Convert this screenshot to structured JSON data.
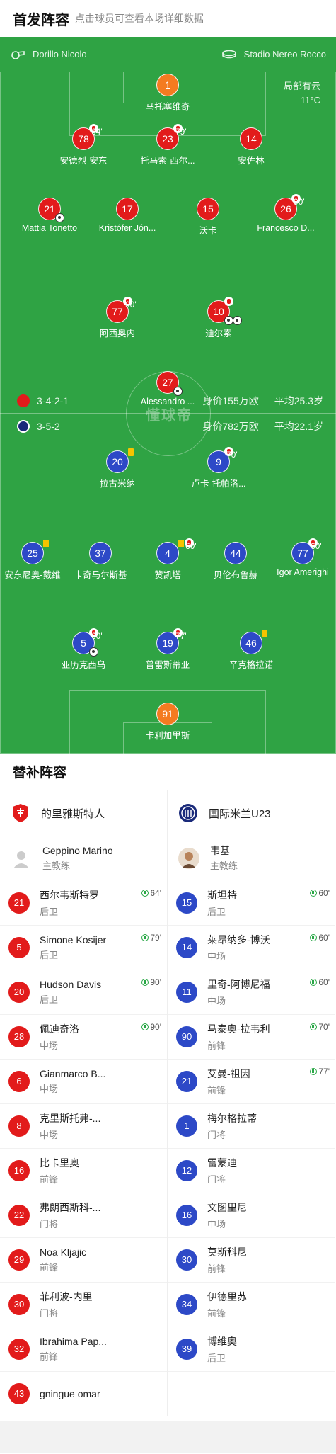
{
  "header": {
    "title": "首发阵容",
    "subtitle": "点击球员可查看本场详细数据"
  },
  "venue": {
    "left": "Dorillo Nicolo",
    "right": "Stadio Nereo Rocco"
  },
  "weather": {
    "line1": "局部有云",
    "line2": "11°C"
  },
  "watermark": "懂球帝",
  "home_team": {
    "formation": "3-4-2-1",
    "value": "身价155万欧",
    "age": "平均25.3岁",
    "color": "#e21b1b"
  },
  "away_team": {
    "formation": "3-5-2",
    "value": "身价782万欧",
    "age": "平均22.1岁",
    "color": "#2d49c7"
  },
  "home_players": [
    {
      "num": "1",
      "name": "马托塞维奇",
      "sub": ""
    },
    {
      "num": "78",
      "name": "安德烈-安东",
      "sub": "64'"
    },
    {
      "num": "23",
      "name": "托马索-西尔...",
      "sub": "79'"
    },
    {
      "num": "14",
      "name": "安佐林",
      "sub": ""
    },
    {
      "num": "21",
      "name": "Mattia Tonetto",
      "sub": ""
    },
    {
      "num": "17",
      "name": "Kristófer Jón...",
      "sub": ""
    },
    {
      "num": "15",
      "name": "沃卡",
      "sub": ""
    },
    {
      "num": "26",
      "name": "Francesco D...",
      "sub": "90'"
    },
    {
      "num": "77",
      "name": "阿西奥内",
      "sub": "90'"
    },
    {
      "num": "10",
      "name": "迪尔索",
      "sub": ""
    },
    {
      "num": "27",
      "name": "Alessandro ...",
      "sub": ""
    }
  ],
  "away_players": [
    {
      "num": "20",
      "name": "拉古米纳",
      "sub": ""
    },
    {
      "num": "9",
      "name": "卢卡-托帕洛...",
      "sub": "70'"
    },
    {
      "num": "25",
      "name": "安东尼奥-戴维",
      "sub": ""
    },
    {
      "num": "37",
      "name": "卡奇马尔斯基",
      "sub": ""
    },
    {
      "num": "4",
      "name": "赞凯塔",
      "sub": "60'"
    },
    {
      "num": "44",
      "name": "贝伦布鲁赫",
      "sub": ""
    },
    {
      "num": "77",
      "name": "Igor Amerighi",
      "sub": "60'"
    },
    {
      "num": "5",
      "name": "亚历克西乌",
      "sub": "60'"
    },
    {
      "num": "19",
      "name": "普雷斯蒂亚",
      "sub": "77'"
    },
    {
      "num": "46",
      "name": "辛克格拉诺",
      "sub": ""
    },
    {
      "num": "91",
      "name": "卡利加里斯",
      "sub": ""
    }
  ],
  "subs": {
    "title": "替补阵容",
    "home": {
      "team": "的里雅斯特人",
      "coach": "Geppino Marino",
      "coach_role": "主教练",
      "players": [
        {
          "num": "21",
          "name": "西尔韦斯特罗",
          "pos": "后卫",
          "in": "64'"
        },
        {
          "num": "5",
          "name": "Simone Kosijer",
          "pos": "后卫",
          "in": "79'"
        },
        {
          "num": "20",
          "name": "Hudson Davis",
          "pos": "后卫",
          "in": "90'"
        },
        {
          "num": "28",
          "name": "佩迪奇洛",
          "pos": "中场",
          "in": "90'"
        },
        {
          "num": "6",
          "name": "Gianmarco B...",
          "pos": "中场",
          "in": ""
        },
        {
          "num": "8",
          "name": "克里斯托弗-...",
          "pos": "中场",
          "in": ""
        },
        {
          "num": "16",
          "name": "比卡里奥",
          "pos": "前锋",
          "in": ""
        },
        {
          "num": "22",
          "name": "弗朗西斯科-...",
          "pos": "门将",
          "in": ""
        },
        {
          "num": "29",
          "name": "Noa Kljajic",
          "pos": "前锋",
          "in": ""
        },
        {
          "num": "30",
          "name": "菲利波-内里",
          "pos": "门将",
          "in": ""
        },
        {
          "num": "32",
          "name": "Ibrahima Pap...",
          "pos": "前锋",
          "in": ""
        },
        {
          "num": "43",
          "name": "gningue omar",
          "pos": "",
          "in": ""
        }
      ]
    },
    "away": {
      "team": "国际米兰U23",
      "coach": "韦基",
      "coach_role": "主教练",
      "players": [
        {
          "num": "15",
          "name": "斯坦特",
          "pos": "后卫",
          "in": "60'"
        },
        {
          "num": "14",
          "name": "莱昂纳多-博沃",
          "pos": "中场",
          "in": "60'"
        },
        {
          "num": "11",
          "name": "里奇-阿博尼福",
          "pos": "中场",
          "in": "60'"
        },
        {
          "num": "90",
          "name": "马泰奥-拉韦利",
          "pos": "前锋",
          "in": "70'"
        },
        {
          "num": "21",
          "name": "艾曼-祖因",
          "pos": "前锋",
          "in": "77'"
        },
        {
          "num": "1",
          "name": "梅尔格拉蒂",
          "pos": "门将",
          "in": ""
        },
        {
          "num": "12",
          "name": "雷蒙迪",
          "pos": "门将",
          "in": ""
        },
        {
          "num": "16",
          "name": "文图里尼",
          "pos": "中场",
          "in": ""
        },
        {
          "num": "30",
          "name": "莫斯科尼",
          "pos": "前锋",
          "in": ""
        },
        {
          "num": "34",
          "name": "伊德里苏",
          "pos": "前锋",
          "in": ""
        },
        {
          "num": "39",
          "name": "博维奥",
          "pos": "后卫",
          "in": ""
        }
      ]
    }
  }
}
